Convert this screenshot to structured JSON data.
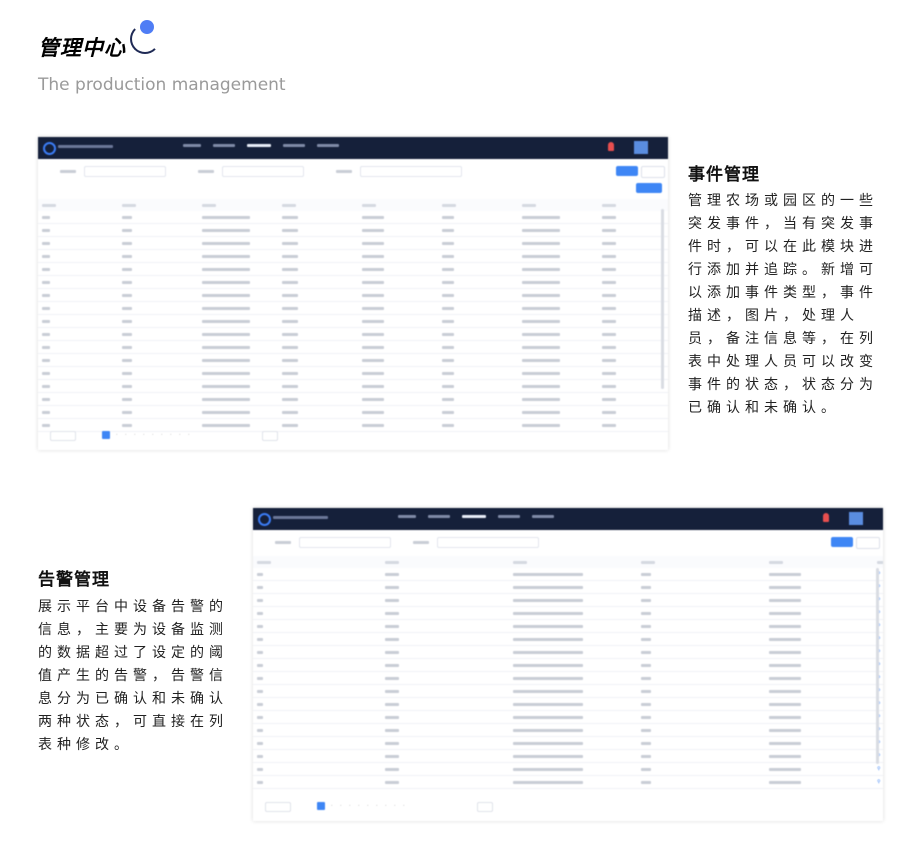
{
  "header": {
    "title": "管理中心",
    "subtitle": "The production management"
  },
  "section1": {
    "title": "事件管理",
    "description": "管理农场或园区的一些突发事件，当有突发事件时，可以在此模块进行添加并追踪。新增可以添加事件类型，事件描述，图片，处理人员，备注信息等，在列表中处理人员可以改变事件的状态，状态分为已确认和未确认。"
  },
  "section2": {
    "title": "告警管理",
    "description": "展示平台中设备告警的信息，主要为设备监测的数据超过了设定的阈值产生的告警，告警信息分为已确认和未确认两种状态，可直接在列表种修改。"
  },
  "colors": {
    "topbar": "#15203a",
    "primary": "#3e86f5",
    "alert_dot": "#e84f4f",
    "title_dot": "#4f7df5"
  },
  "icons": {
    "logo": "ring-logo-icon",
    "bell": "bell-icon",
    "avatar": "avatar-icon",
    "ops": [
      "user-icon",
      "edit-icon",
      "delete-icon"
    ]
  }
}
